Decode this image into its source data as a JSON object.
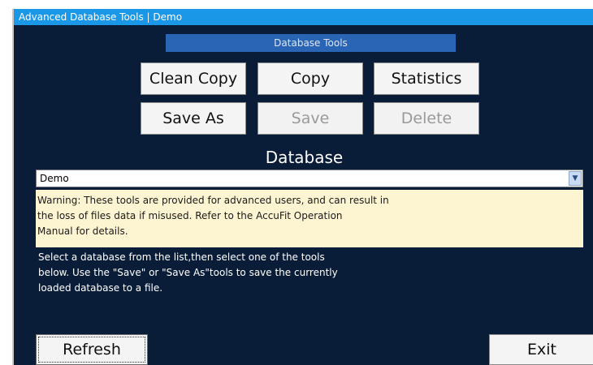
{
  "window": {
    "title": "Advanced Database Tools | Demo"
  },
  "tools": {
    "header": "Database Tools",
    "buttons": [
      {
        "label": "Clean Copy",
        "enabled": true
      },
      {
        "label": "Copy",
        "enabled": true
      },
      {
        "label": "Statistics",
        "enabled": true
      },
      {
        "label": "Save As",
        "enabled": true
      },
      {
        "label": "Save",
        "enabled": false
      },
      {
        "label": "Delete",
        "enabled": false
      }
    ]
  },
  "database": {
    "label": "Database",
    "selected": "Demo",
    "dropdown_icon": "chevron-down-icon"
  },
  "warning": {
    "lines": [
      "Warning: These tools are provided for advanced users, and can result in",
      "the loss of files data if misused. Refer to the AccuFit Operation",
      "Manual for details."
    ]
  },
  "info": {
    "lines": [
      "Select a database from the list,then select one of the tools",
      "below. Use the \"Save\" or \"Save As\"tools to save the currently",
      "loaded database to a file."
    ]
  },
  "footer": {
    "refresh_label": "Refresh",
    "exit_label": "Exit"
  },
  "colors": {
    "background": "#0a1d38",
    "titlebar": "#1a97e6",
    "section_header": "#2a64b4",
    "warning_bg": "#fdf5d2"
  }
}
